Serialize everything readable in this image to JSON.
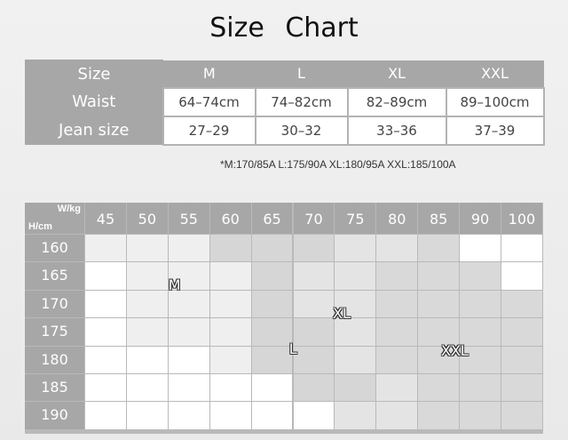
{
  "title": "Size  Chart",
  "size_table": {
    "headers": [
      "Size",
      "M",
      "L",
      "XL",
      "XXL"
    ],
    "rows": [
      {
        "label": "Waist",
        "values": [
          "64–74cm",
          "74–82cm",
          "82–89cm",
          "89–100cm"
        ]
      },
      {
        "label": "Jean size",
        "values": [
          "27–29",
          "30–32",
          "33–36",
          "37–39"
        ]
      }
    ]
  },
  "note": "*M:170/85A   L:175/90A   XL:180/95A   XXL:185/100A",
  "grid": {
    "corner_w": "W/kg",
    "corner_h": "H/cm",
    "weights": [
      "45",
      "50",
      "55",
      "60",
      "65",
      "70",
      "75",
      "80",
      "85",
      "90",
      "100"
    ],
    "heights": [
      "160",
      "165",
      "170",
      "175",
      "180",
      "185",
      "190"
    ],
    "zone_labels": [
      "M",
      "XL",
      "L",
      "XXL"
    ],
    "zone_colors": {
      "white": "#ffffff",
      "M": "#efefef",
      "L": "#d6d6d6",
      "XL": "#e4e4e4",
      "XXL": "#d9d9d9",
      "dark": "#d0d0d0"
    }
  }
}
